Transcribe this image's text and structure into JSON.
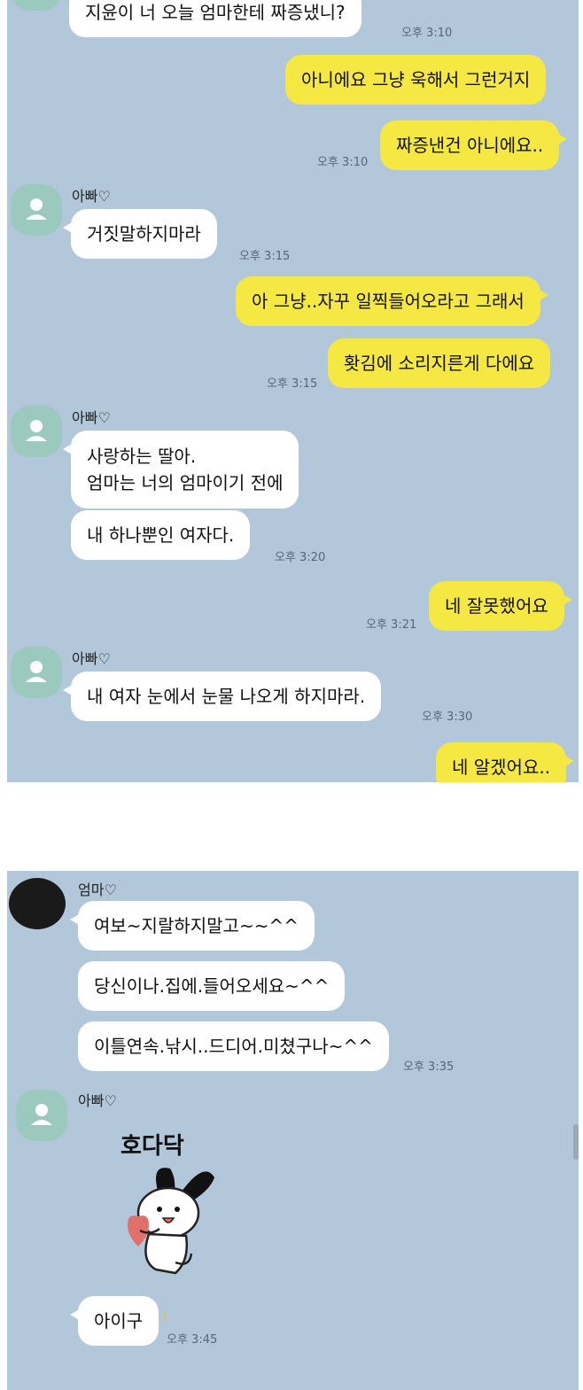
{
  "colors": {
    "chat_bg": "#b2c7da",
    "incoming_bubble": "#ffffff",
    "outgoing_bubble": "#f6e843",
    "avatar_green": "#9cc9bd"
  },
  "screenshot1": {
    "messages": [
      {
        "text": "지윤이 너 오늘 엄마한테 짜증냈니?",
        "time": "오후 3:10"
      },
      {
        "text": "아니에요 그냥 욱해서 그런거지"
      },
      {
        "text": "짜증낸건 아니에요..",
        "time": "오후 3:10"
      },
      {
        "sender": "아빠♡",
        "text": "거짓말하지마라",
        "time": "오후 3:15"
      },
      {
        "text": "아 그냥..자꾸 일찍들어오라고 그래서"
      },
      {
        "text": "홧김에 소리지른게 다에요",
        "time": "오후 3:15"
      },
      {
        "sender": "아빠♡",
        "lines": [
          "사랑하는 딸아.",
          "엄마는 너의 엄마이기 전에"
        ]
      },
      {
        "text": "내 하나뿐인 여자다.",
        "time": "오후 3:20"
      },
      {
        "text": "네 잘못했어요",
        "time": "오후 3:21"
      },
      {
        "sender": "아빠♡",
        "text": "내 여자 눈에서 눈물 나오게 하지마라.",
        "time": "오후 3:30"
      },
      {
        "text": "네 알겠어요.."
      }
    ]
  },
  "screenshot2": {
    "messages": [
      {
        "sender": "엄마♡",
        "text": "여보~지랄하지말고~~^^"
      },
      {
        "text": "당신이나.집에.들어오세요~^^"
      },
      {
        "text": "이틀연속.낚시..드디어.미쳤구나~^^",
        "time": "오후 3:35"
      },
      {
        "sender": "아빠♡",
        "sticker_text": "호다닥"
      },
      {
        "text": "아이구",
        "unread": "1",
        "time": "오후 3:45"
      }
    ]
  }
}
